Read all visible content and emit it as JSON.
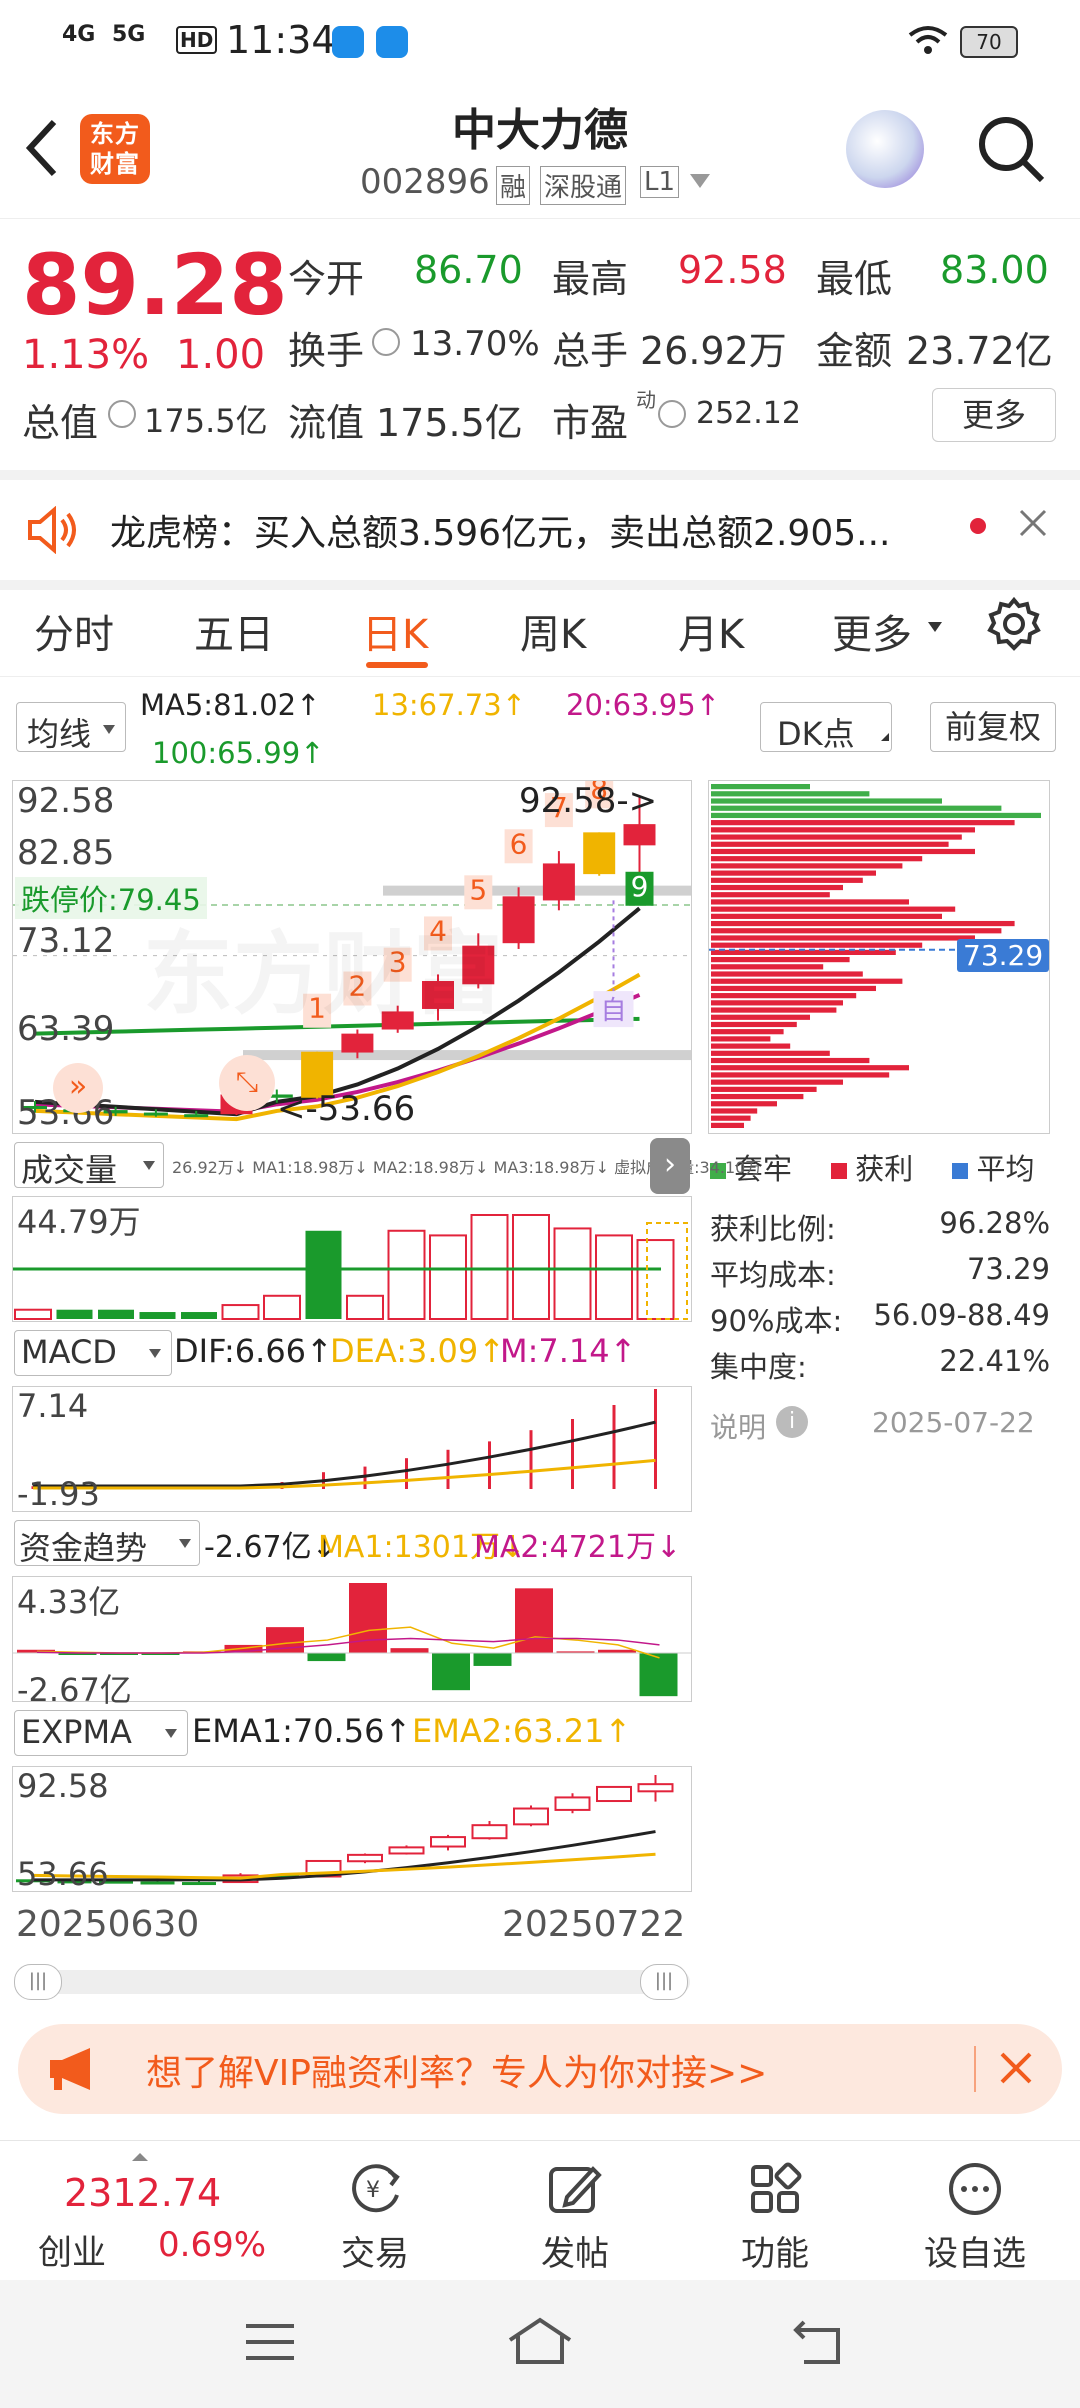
{
  "status_bar": {
    "network1": "4G",
    "network2": "5G",
    "hd": "HD",
    "time": "11:34",
    "battery": "70"
  },
  "header": {
    "logo": "东方财富",
    "name": "中大力德",
    "code": "002896",
    "tag1": "融",
    "tag2": "深股通",
    "tag3": "L1"
  },
  "quote": {
    "price": "89.28",
    "change_pct": "1.13%",
    "change": "1.00",
    "open_label": "今开",
    "open": "86.70",
    "high_label": "最高",
    "high": "92.58",
    "low_label": "最低",
    "low": "83.00",
    "turnover_label": "换手",
    "turnover": "13.70%",
    "volume_label": "总手",
    "volume": "26.92万",
    "amount_label": "金额",
    "amount": "23.72亿",
    "mcap_label": "总值",
    "mcap": "175.5亿",
    "float_label": "流值",
    "float": "175.5亿",
    "pe_label": "市盈",
    "pe_sup": "动",
    "pe": "252.12",
    "more": "更多"
  },
  "notice": {
    "text": "龙虎榜：买入总额3.596亿元，卖出总额2.905..."
  },
  "tabs": [
    "分时",
    "五日",
    "日K",
    "周K",
    "月K",
    "更多"
  ],
  "active_tab": "日K",
  "ma_bar": {
    "selector": "均线",
    "ma5": "MA5:81.02↑",
    "ma13": "13:67.73↑",
    "ma20": "20:63.95↑",
    "ma100": "100:65.99↑",
    "dk": "DK点",
    "fq": "前复权"
  },
  "kline": {
    "y_labels": [
      "92.58",
      "82.85",
      "73.12",
      "63.39",
      "53.66"
    ],
    "limit_down": "跌停价:79.45",
    "max_note": "92.58->",
    "min_note": "<-53.66",
    "seq_labels": [
      "1",
      "2",
      "3",
      "4",
      "5",
      "6",
      "7",
      "8",
      "9"
    ],
    "zi": "自",
    "watermark": "东方财富"
  },
  "chip": {
    "avg_price": "73.29",
    "legend": [
      "套牢",
      "获利",
      "平均"
    ],
    "legend_colors": [
      "#3fae49",
      "#e2233b",
      "#3a7bd5"
    ],
    "rows": [
      {
        "label": "获利比例:",
        "value": "96.28%"
      },
      {
        "label": "平均成本:",
        "value": "73.29"
      },
      {
        "label": "90%成本:",
        "value": "56.09-88.49"
      },
      {
        "label": "集中度:",
        "value": "22.41%"
      }
    ],
    "note_label": "说明",
    "date": "2025-07-22"
  },
  "volume": {
    "selector": "成交量",
    "stats": "26.92万↓ MA1:18.98万↓ MA2:18.98万↓ MA3:18.98万↓ 虚拟成交量:34.10万",
    "y_max": "44.79万"
  },
  "macd": {
    "selector": "MACD",
    "dif": "DIF:6.66↑",
    "dea": "DEA:3.09↑",
    "m": "M:7.14↑",
    "y_max": "7.14",
    "y_min": "-1.93"
  },
  "fund": {
    "selector": "资金趋势",
    "value": "-2.67亿↓",
    "ma1": "MA1:1301万↓",
    "ma2": "MA2:4721万↓",
    "y_max": "4.33亿",
    "y_min": "-2.67亿"
  },
  "expma": {
    "selector": "EXPMA",
    "ema1": "EMA1:70.56↑",
    "ema2": "EMA2:63.21↑",
    "y_max": "92.58",
    "y_min": "53.66"
  },
  "dates": {
    "start": "20250630",
    "end": "20250722"
  },
  "promo": {
    "text": "想了解VIP融资利率？专人为你对接>>"
  },
  "bottom_nav": {
    "index_value": "2312.74",
    "index_name": "创业",
    "index_pct": "0.69%",
    "items": [
      "交易",
      "发帖",
      "功能",
      "设自选"
    ]
  },
  "chart_data": {
    "type": "candlestick",
    "dates": {
      "start": "20250630",
      "end": "20250722"
    },
    "candles": [
      {
        "o": 55.0,
        "c": 54.8,
        "h": 55.6,
        "l": 54.2
      },
      {
        "o": 54.6,
        "c": 54.4,
        "h": 55.0,
        "l": 53.9
      },
      {
        "o": 54.5,
        "c": 54.1,
        "h": 54.9,
        "l": 53.8
      },
      {
        "o": 54.2,
        "c": 54.0,
        "h": 54.6,
        "l": 53.7
      },
      {
        "o": 54.0,
        "c": 53.8,
        "h": 54.4,
        "l": 53.66
      },
      {
        "o": 54.0,
        "c": 56.4,
        "h": 57.2,
        "l": 53.9
      },
      {
        "o": 56.4,
        "c": 56.0,
        "h": 57.0,
        "l": 55.4
      },
      {
        "o": 56.0,
        "c": 61.6,
        "h": 61.6,
        "l": 55.9
      },
      {
        "o": 61.5,
        "c": 63.8,
        "h": 64.3,
        "l": 60.8
      },
      {
        "o": 64.3,
        "c": 66.5,
        "h": 67.2,
        "l": 63.9
      },
      {
        "o": 66.8,
        "c": 70.2,
        "h": 71.0,
        "l": 65.4
      },
      {
        "o": 69.8,
        "c": 74.5,
        "h": 76.0,
        "l": 69.3
      },
      {
        "o": 74.8,
        "c": 80.5,
        "h": 81.6,
        "l": 74.1
      },
      {
        "o": 80.0,
        "c": 84.5,
        "h": 86.0,
        "l": 78.8
      },
      {
        "o": 83.2,
        "c": 88.28,
        "h": 88.28,
        "l": 83.0
      },
      {
        "o": 86.7,
        "c": 89.28,
        "h": 92.58,
        "l": 83.0
      }
    ]
  }
}
